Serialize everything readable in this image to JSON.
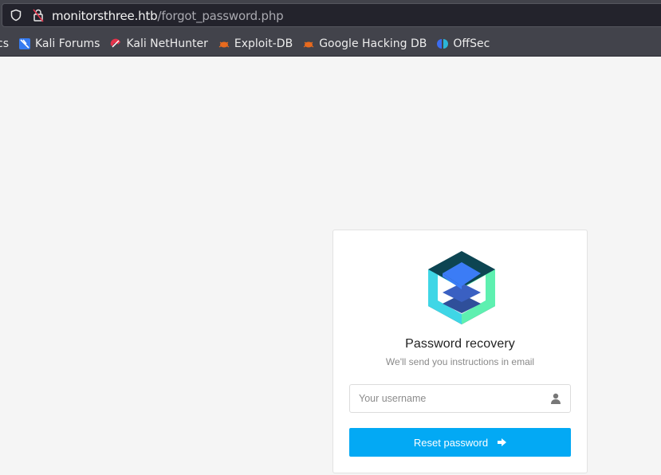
{
  "browser": {
    "url_host": "monitorsthree.htb",
    "url_path": "/forgot_password.php",
    "bookmarks": [
      {
        "label": "cs",
        "icon": "truncated-bookmark"
      },
      {
        "label": "Kali Forums",
        "icon": "kali-forums-icon"
      },
      {
        "label": "Kali NetHunter",
        "icon": "kali-nethunter-icon"
      },
      {
        "label": "Exploit-DB",
        "icon": "exploit-db-icon"
      },
      {
        "label": "Google Hacking DB",
        "icon": "ghdb-icon"
      },
      {
        "label": "OffSec",
        "icon": "offsec-icon"
      }
    ]
  },
  "card": {
    "title": "Password recovery",
    "subtitle": "We'll send you instructions in email",
    "username_placeholder": "Your username",
    "username_value": "",
    "submit_label": "Reset password"
  },
  "colors": {
    "accent": "#03a9f4",
    "page_bg": "#f5f5f5",
    "logo_dark": "#0d4552",
    "logo_cyan": "#3fd6e6",
    "logo_green": "#5ef0b0",
    "logo_blue": "#3b7cf6"
  }
}
